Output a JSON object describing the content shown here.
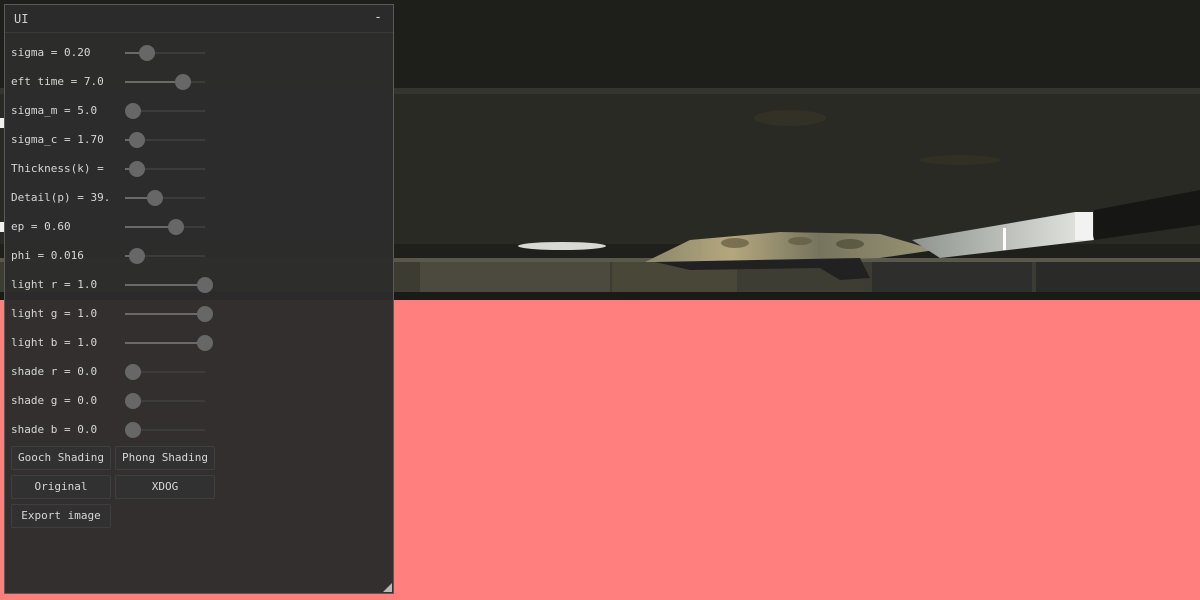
{
  "window": {
    "title": "UI",
    "minimize_glyph": "-"
  },
  "sliders": [
    {
      "id": "sigma",
      "label": "sigma = 0.20",
      "fraction": 0.2
    },
    {
      "id": "eft-time",
      "label": "eft time = 7.0",
      "fraction": 0.7
    },
    {
      "id": "sigma-m",
      "label": "sigma_m = 5.0",
      "fraction": 0.0
    },
    {
      "id": "sigma-c",
      "label": "sigma_c = 1.70",
      "fraction": 0.06
    },
    {
      "id": "thickness-k",
      "label": "Thickness(k) =",
      "fraction": 0.05
    },
    {
      "id": "detail-p",
      "label": "Detail(p) = 39.",
      "fraction": 0.3
    },
    {
      "id": "ep",
      "label": "ep = 0.60",
      "fraction": 0.6
    },
    {
      "id": "phi",
      "label": "phi = 0.016",
      "fraction": 0.05
    },
    {
      "id": "light-r",
      "label": "light r = 1.0",
      "fraction": 1.0
    },
    {
      "id": "light-g",
      "label": "light g = 1.0",
      "fraction": 1.0
    },
    {
      "id": "light-b",
      "label": "light b = 1.0",
      "fraction": 1.0
    },
    {
      "id": "shade-r",
      "label": "shade r = 0.0",
      "fraction": 0.0
    },
    {
      "id": "shade-g",
      "label": "shade g = 0.0",
      "fraction": 0.0
    },
    {
      "id": "shade-b",
      "label": "shade b = 0.0",
      "fraction": 0.0
    }
  ],
  "buttons": {
    "gooch": "Gooch Shading",
    "phong": "Phong Shading",
    "original": "Original",
    "xdog": "XDOG",
    "export": "Export image"
  },
  "colors": {
    "background": "#ff7f7f",
    "window_bg": "#2c2c2c",
    "slider_thumb": "#676767"
  }
}
